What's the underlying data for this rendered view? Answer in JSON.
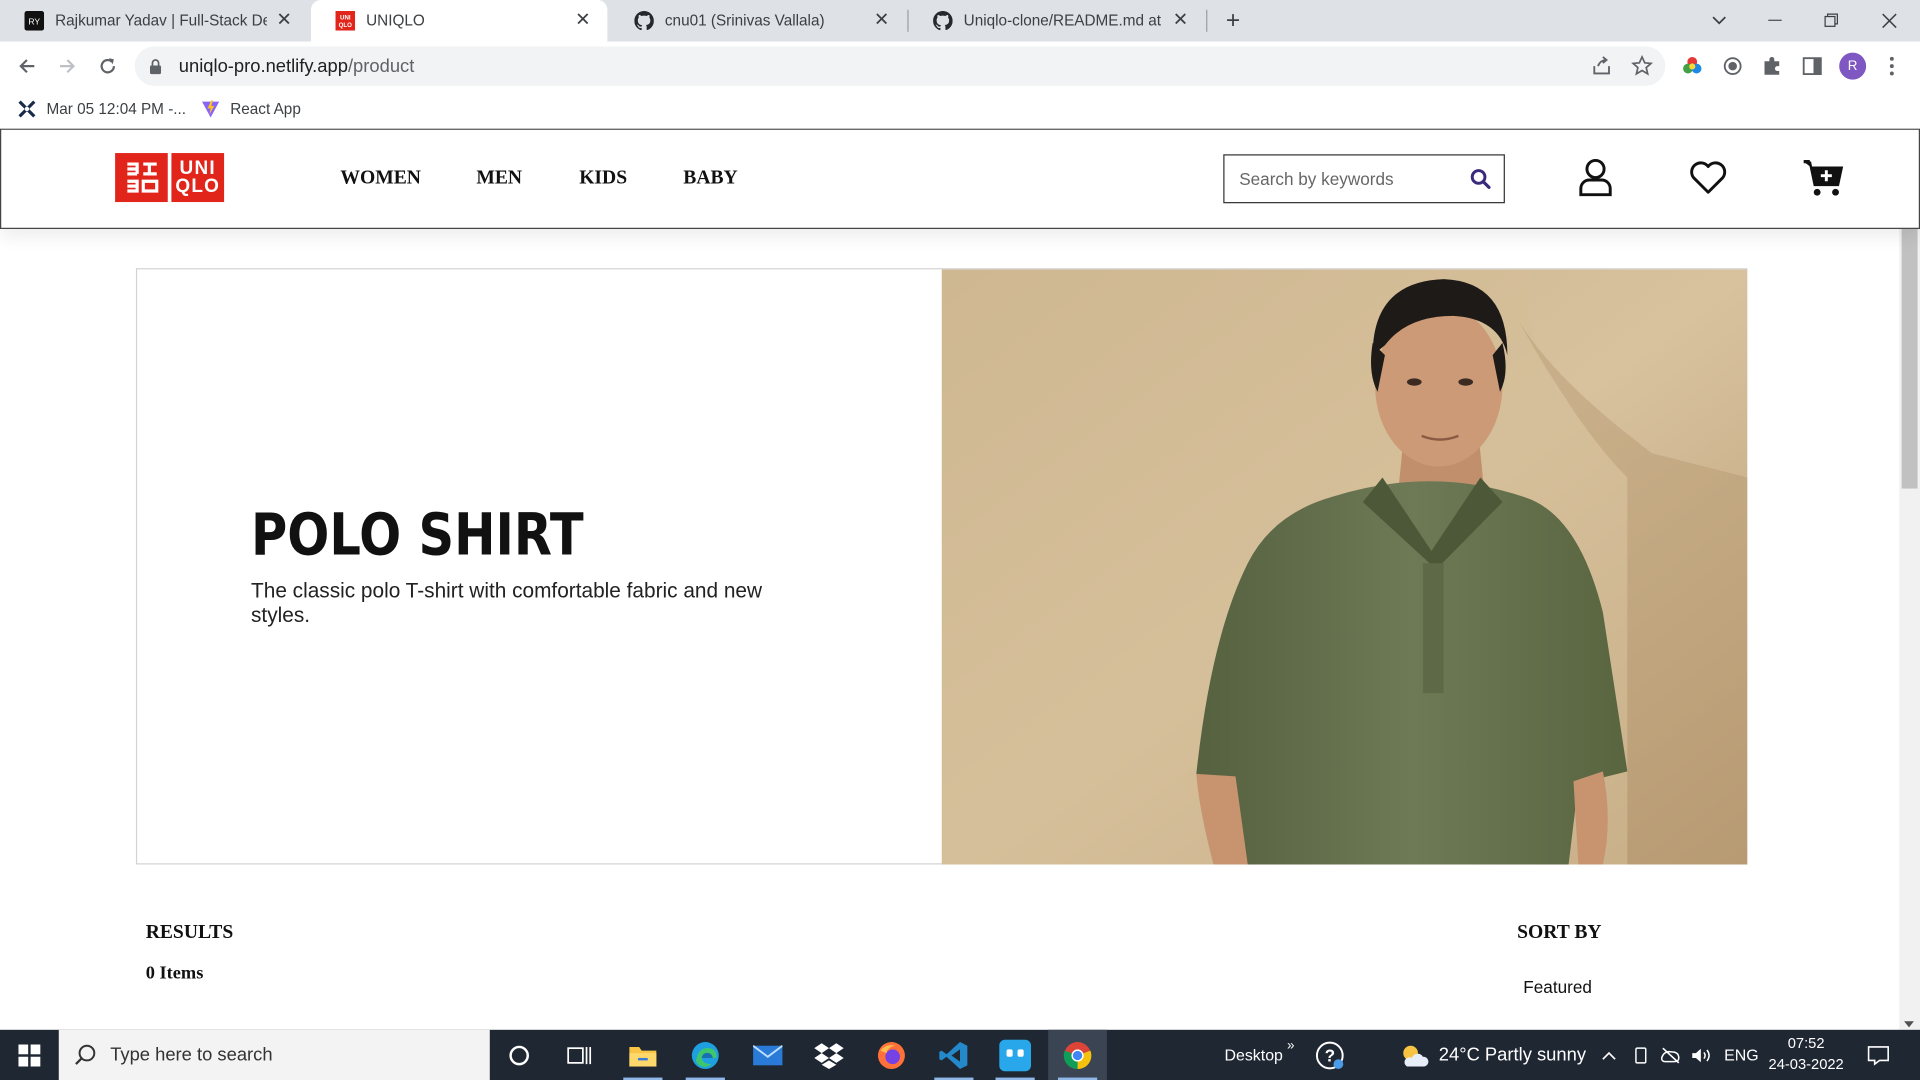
{
  "browser": {
    "tabs": [
      {
        "title": "Rajkumar Yadav | Full-Stack Deve",
        "active": false
      },
      {
        "title": "UNIQLO",
        "active": true
      },
      {
        "title": "cnu01 (Srinivas Vallala)",
        "active": false
      },
      {
        "title": "Uniqlo-clone/README.md at ma",
        "active": false
      }
    ],
    "new_tab_symbol": "+",
    "url_domain": "uniqlo-pro.netlify.app",
    "url_path": "/product",
    "profile_initial": "R",
    "bookmarks": [
      {
        "label": "Mar 05 12:04 PM -...",
        "icon": "x-logo-icon"
      },
      {
        "label": "React App",
        "icon": "vite-icon"
      }
    ]
  },
  "site": {
    "logo": {
      "line1": "UNI",
      "line2": "QLO",
      "color": "#e1251b"
    },
    "nav": [
      "WOMEN",
      "MEN",
      "KIDS",
      "BABY"
    ],
    "search_placeholder": "Search by keywords",
    "accent": "#3a2a7d"
  },
  "banner": {
    "title": "POLO SHIRT",
    "description": "The classic polo T-shirt with comfortable fabric and new styles."
  },
  "results": {
    "label": "RESULTS",
    "count": "0 Items"
  },
  "sort": {
    "label": "SORT BY",
    "value": "Featured"
  },
  "taskbar": {
    "search_placeholder": "Type here to search",
    "desktop_label": "Desktop",
    "weather": "24°C  Partly sunny",
    "language": "ENG",
    "time": "07:52",
    "date": "24-03-2022"
  }
}
